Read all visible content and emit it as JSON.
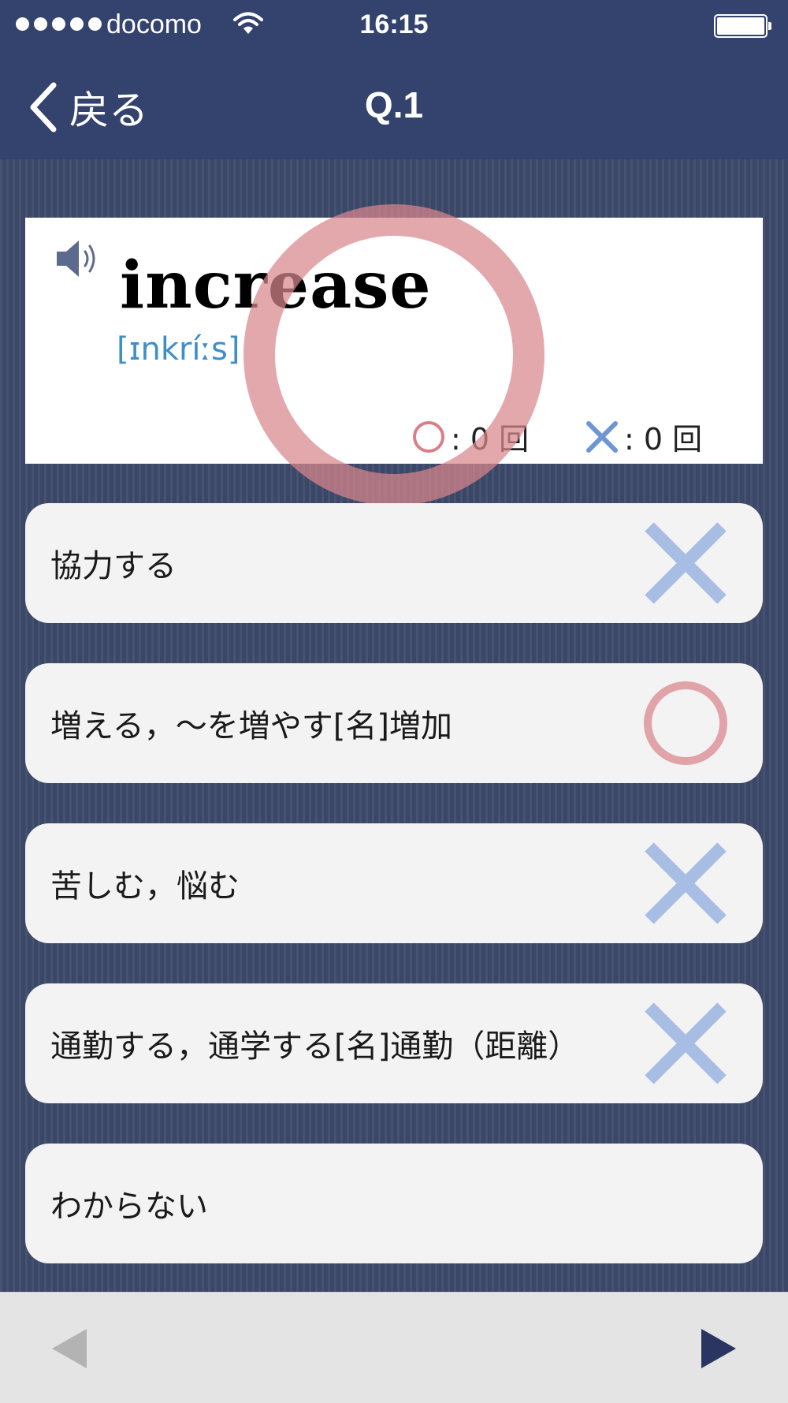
{
  "status_bar": {
    "carrier": "docomo",
    "time": "16:15"
  },
  "nav": {
    "back_label": "戻る",
    "title": "Q.1"
  },
  "word_card": {
    "word": "increase",
    "pronunciation": "[ɪnkríːs]",
    "correct_count": ": 0 回",
    "wrong_count": ": 0 回"
  },
  "choices": [
    {
      "label": "協力する",
      "mark": "cross"
    },
    {
      "label": "増える，～を増やす[名]増加",
      "mark": "circle"
    },
    {
      "label": "苦しむ，悩む",
      "mark": "cross"
    },
    {
      "label": "通勤する，通学する[名]通勤（距離）",
      "mark": "cross"
    },
    {
      "label": "わからない",
      "mark": "none"
    }
  ],
  "colors": {
    "nav_bg": "#34436e",
    "circle_mark": "#e0a3a7",
    "cross_mark": "#a7bde3",
    "pronunciation": "#3f8fc7"
  },
  "icons": {
    "back": "chevron-left-icon",
    "speaker": "speaker-icon",
    "prev": "triangle-left-icon",
    "next": "triangle-right-icon"
  }
}
